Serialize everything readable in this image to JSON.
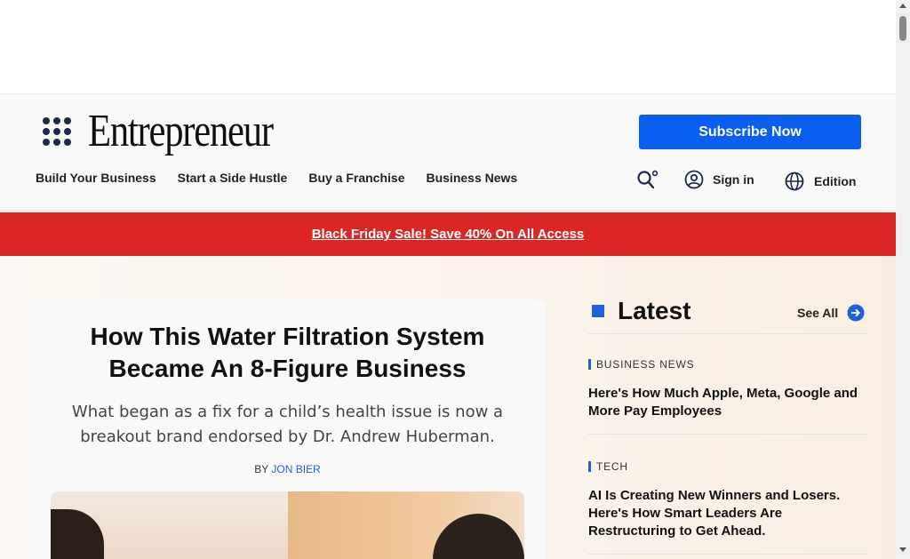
{
  "header": {
    "logo_text": "Entrepreneur",
    "subscribe_label": "Subscribe Now",
    "nav_items": [
      "Build Your Business",
      "Start a Side Hustle",
      "Buy a Franchise",
      "Business News"
    ],
    "signin_label": "Sign in",
    "edition_label": "Edition"
  },
  "promo": {
    "text": "Black Friday Sale! Save 40% On All Access"
  },
  "feature": {
    "title": "How This Water Filtration System Became An 8-Figure Business",
    "dek": "What began as a fix for a child’s health issue is now a breakout brand endorsed by Dr. Andrew Huberman.",
    "by_prefix": "BY",
    "author": "JON BIER"
  },
  "latest": {
    "title": "Latest",
    "see_all_label": "See All",
    "items": [
      {
        "category": "BUSINESS NEWS",
        "headline": "Here's How Much Apple, Meta, Google and More Pay Employees"
      },
      {
        "category": "TECH",
        "headline": "AI Is Creating New Winners and Losers. Here's How Smart Leaders Are Restructuring to Get Ahead."
      }
    ]
  },
  "colors": {
    "brand_blue": "#0a5ef0",
    "promo_red": "#dc2626",
    "accent_blue": "#1d5fe0"
  },
  "icons": [
    "apps-grid-icon",
    "search-icon",
    "user-icon",
    "globe-icon",
    "arrow-right-icon"
  ]
}
